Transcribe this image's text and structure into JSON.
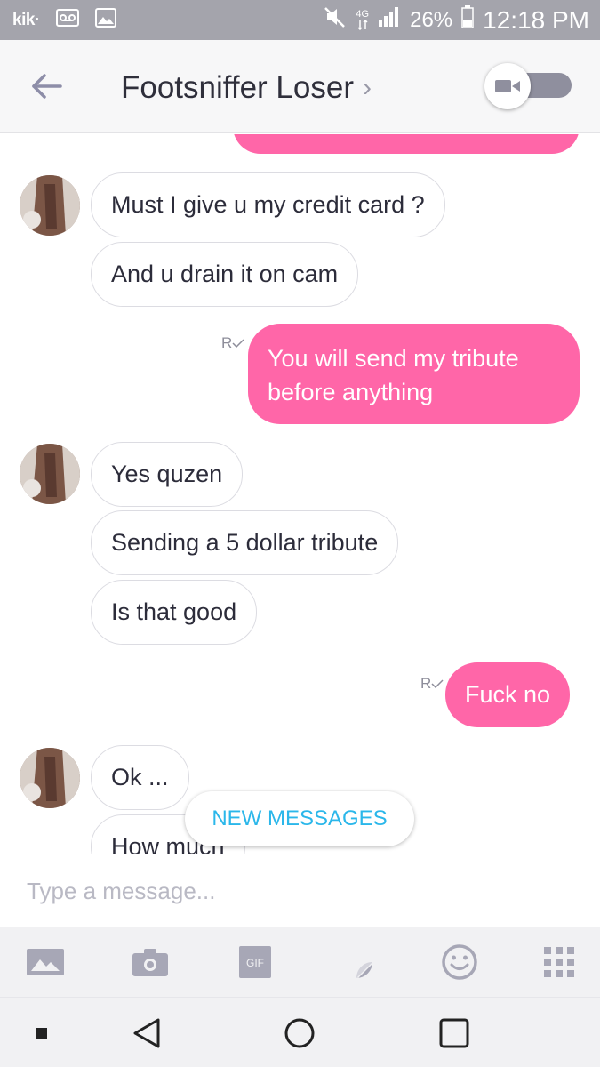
{
  "status_bar": {
    "app_label": "kik·",
    "battery": "26%",
    "time": "12:18 PM",
    "network": "4G"
  },
  "header": {
    "title": "Footsniffer Loser",
    "title_chevron": "›"
  },
  "messages": [
    {
      "side": "in",
      "text": "Must I give u my credit card ?"
    },
    {
      "side": "in",
      "text": "And u drain it on cam"
    },
    {
      "side": "out",
      "text": "You will send my tribute before anything",
      "lines": [
        "You will send my tribute",
        "before anything"
      ],
      "receipt": "R"
    },
    {
      "side": "in",
      "text": "Yes quzen"
    },
    {
      "side": "in",
      "text": "Sending a 5 dollar tribute"
    },
    {
      "side": "in",
      "text": "Is that good"
    },
    {
      "side": "out",
      "text": "Fuck no",
      "receipt": "R"
    },
    {
      "side": "in",
      "text": "Ok ..."
    },
    {
      "side": "in",
      "text": "How much"
    }
  ],
  "new_messages_label": "NEW MESSAGES",
  "composer": {
    "placeholder": "Type a message..."
  },
  "toolbar": {
    "icons": [
      "gallery-icon",
      "camera-icon",
      "gif-icon",
      "sticker-icon",
      "emoji-icon",
      "apps-grid-icon"
    ],
    "gif_label": "GIF"
  },
  "nav_bar": {
    "icons": [
      "recent-dot-icon",
      "back-triangle-icon",
      "home-circle-icon",
      "overview-square-icon"
    ]
  },
  "colors": {
    "status_bar": "#a4a4ac",
    "outgoing_bubble": "#ff66a8",
    "new_messages_text": "#2bb7ea",
    "icon_gray": "#a7a7b6"
  }
}
